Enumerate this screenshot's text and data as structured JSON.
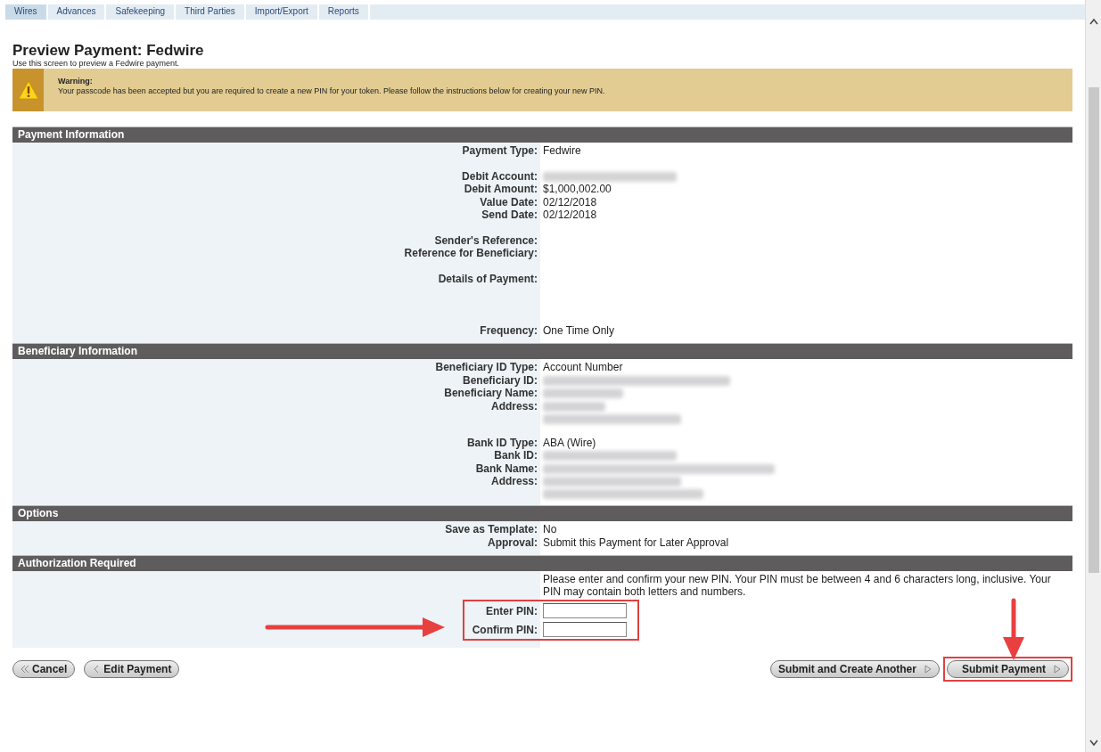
{
  "tabs": [
    {
      "label": "Wires",
      "selected": true
    },
    {
      "label": "Advances",
      "selected": false
    },
    {
      "label": "Safekeeping",
      "selected": false
    },
    {
      "label": "Third Parties",
      "selected": false
    },
    {
      "label": "Import/Export",
      "selected": false
    },
    {
      "label": "Reports",
      "selected": false
    }
  ],
  "page": {
    "title": "Preview Payment: Fedwire",
    "subtitle": "Use this screen to preview a Fedwire payment."
  },
  "warning": {
    "heading": "Warning:",
    "message": "Your passcode has been accepted but you are required to create a new PIN for your token. Please follow the instructions below for creating your new PIN."
  },
  "sections": [
    {
      "title": "Payment Information",
      "groups": [
        [
          {
            "label": "Payment Type:",
            "kind": "text",
            "value": "Fedwire"
          }
        ],
        [
          {
            "label": "Debit Account:",
            "kind": "redacted"
          },
          {
            "label": "Debit Amount:",
            "kind": "text",
            "value": "$1,000,002.00"
          },
          {
            "label": "Value Date:",
            "kind": "text",
            "value": "02/12/2018"
          },
          {
            "label": "Send Date:",
            "kind": "text",
            "value": "02/12/2018"
          }
        ],
        [
          {
            "label": "Sender's Reference:",
            "kind": "empty"
          },
          {
            "label": "Reference for Beneficiary:",
            "kind": "empty"
          }
        ],
        [
          {
            "label": "Details of Payment:",
            "kind": "tall"
          }
        ],
        [
          {
            "label": "Frequency:",
            "kind": "text",
            "value": "One Time Only"
          }
        ]
      ]
    },
    {
      "title": "Beneficiary Information",
      "groups": [
        [
          {
            "label": "Beneficiary ID Type:",
            "kind": "text",
            "value": "Account Number"
          },
          {
            "label": "Beneficiary ID:",
            "kind": "redacted"
          },
          {
            "label": "Beneficiary Name:",
            "kind": "redacted"
          },
          {
            "label": "Address:",
            "kind": "redacted_two_lines"
          }
        ],
        [
          {
            "label": "Bank ID Type:",
            "kind": "text",
            "value": "ABA (Wire)"
          },
          {
            "label": "Bank ID:",
            "kind": "redacted"
          },
          {
            "label": "Bank Name:",
            "kind": "redacted"
          },
          {
            "label": "Address:",
            "kind": "redacted_two_lines"
          }
        ]
      ]
    },
    {
      "title": "Options",
      "groups": [
        [
          {
            "label": "Save as Template:",
            "kind": "text",
            "value": "No"
          },
          {
            "label": "Approval:",
            "kind": "text",
            "value": "Submit this Payment for Later Approval"
          }
        ]
      ]
    }
  ],
  "authorization": {
    "title": "Authorization Required",
    "instructions": "Please enter and confirm your new PIN. Your PIN must be between 4 and 6 characters long, inclusive. Your PIN may contain both letters and numbers.",
    "fields": [
      {
        "label": "Enter PIN:"
      },
      {
        "label": "Confirm PIN:"
      }
    ]
  },
  "buttons_left": [
    {
      "label": "Cancel"
    },
    {
      "label": "Edit Payment"
    }
  ],
  "buttons_right": [
    {
      "label": "Submit and Create Another",
      "highlighted": false
    },
    {
      "label": "Submit Payment",
      "highlighted": true
    }
  ]
}
